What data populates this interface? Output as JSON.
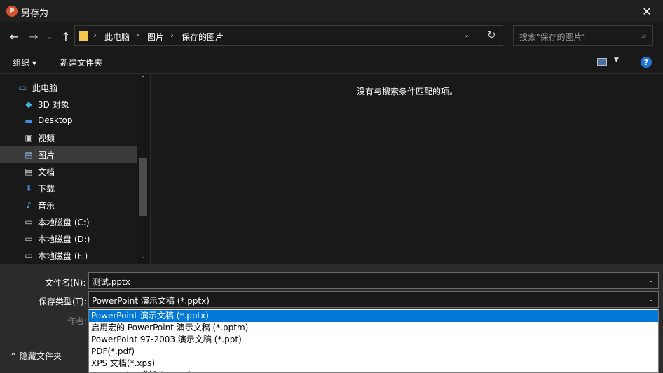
{
  "window": {
    "title": "另存为",
    "app_icon_letter": "P",
    "close_glyph": "✕"
  },
  "nav": {
    "back_glyph": "←",
    "forward_glyph": "→",
    "recent_glyph": "⌄",
    "up_glyph": "↑",
    "breadcrumbs": [
      "此电脑",
      "图片",
      "保存的图片"
    ],
    "separator": "›",
    "dropdown_glyph": "⌄",
    "refresh_glyph": "↻",
    "search_placeholder": "搜索\"保存的图片\"",
    "search_glyph": "⌕"
  },
  "toolbar": {
    "organize_label": "组织 ▾",
    "new_folder_label": "新建文件夹",
    "help_glyph": "?"
  },
  "sidebar": {
    "items": [
      {
        "label": "此电脑",
        "icon": "computer-icon",
        "glyph": "▭",
        "color": "#5fa8e8"
      },
      {
        "label": "3D 对象",
        "icon": "cube-3d-icon",
        "glyph": "◆",
        "color": "#3fb3d9"
      },
      {
        "label": "Desktop",
        "icon": "desktop-icon",
        "glyph": "▬",
        "color": "#3f8fe0"
      },
      {
        "label": "视频",
        "icon": "video-icon",
        "glyph": "▣",
        "color": "#cccccc"
      },
      {
        "label": "图片",
        "icon": "pictures-icon",
        "glyph": "▤",
        "color": "#8fbde8"
      },
      {
        "label": "文档",
        "icon": "documents-icon",
        "glyph": "▤",
        "color": "#e8e8e8"
      },
      {
        "label": "下载",
        "icon": "downloads-icon",
        "glyph": "⬇",
        "color": "#3f8fe0"
      },
      {
        "label": "音乐",
        "icon": "music-icon",
        "glyph": "♪",
        "color": "#3fa8e8"
      },
      {
        "label": "本地磁盘 (C:)",
        "icon": "drive-windows-icon",
        "glyph": "▭",
        "color": "#cfcfcf"
      },
      {
        "label": "本地磁盘 (D:)",
        "icon": "drive-icon",
        "glyph": "▭",
        "color": "#cfcfcf"
      },
      {
        "label": "本地磁盘 (F:)",
        "icon": "drive-icon",
        "glyph": "▭",
        "color": "#cfcfcf"
      }
    ],
    "selected_index": 4,
    "scroll_up_glyph": "⌃",
    "scroll_down_glyph": "⌄"
  },
  "main": {
    "empty_message": "没有与搜索条件匹配的项。"
  },
  "form": {
    "filename_label": "文件名(N):",
    "filename_value": "测试.pptx",
    "filetype_label": "保存类型(T):",
    "filetype_value": "PowerPoint 演示文稿 (*.pptx)",
    "author_label": "作者:",
    "caret_glyph": "⌄"
  },
  "filetype_options": [
    "PowerPoint 演示文稿 (*.pptx)",
    "启用宏的 PowerPoint 演示文稿 (*.pptm)",
    "PowerPoint 97-2003 演示文稿 (*.ppt)",
    "PDF(*.pdf)",
    "XPS 文档(*.xps)",
    "PowerPoint 模板 (*.potx)"
  ],
  "hide_folders_label": "⌃  隐藏文件夹",
  "colors": {
    "accent": "#0078d7",
    "background": "#191919",
    "panel": "#2b2b2b"
  }
}
